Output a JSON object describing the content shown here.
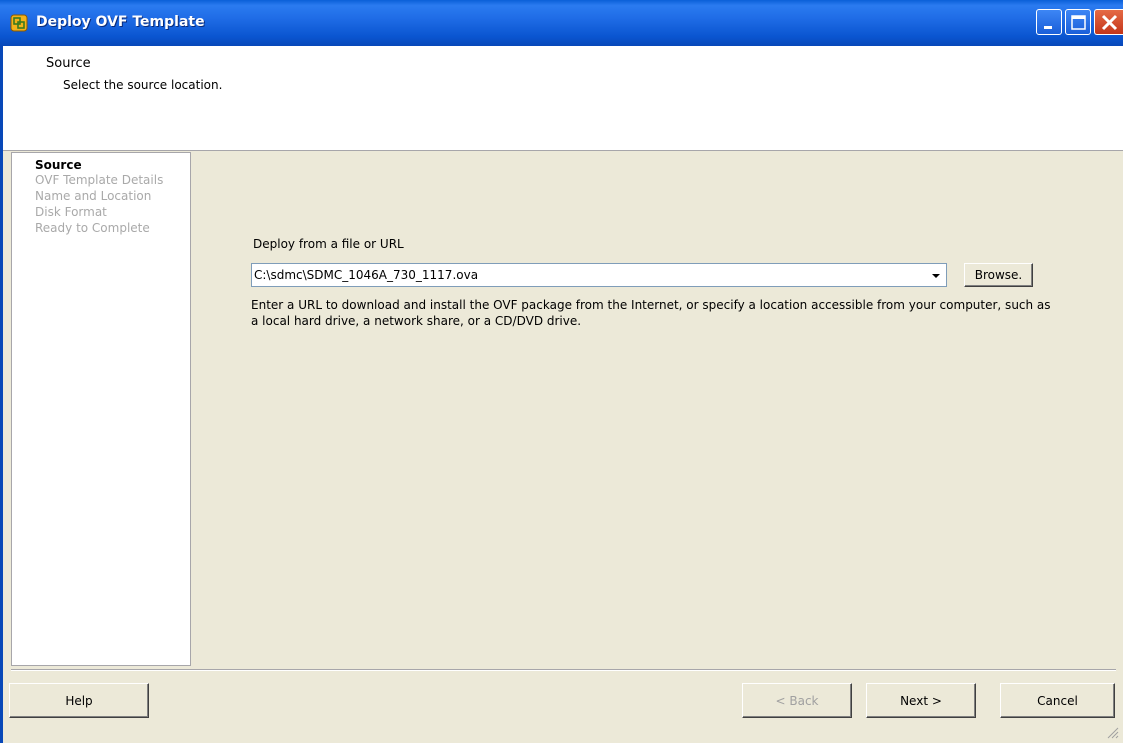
{
  "window": {
    "title": "Deploy OVF Template",
    "icons": {
      "app": "ovf-app-icon",
      "minimize": "minimize-icon",
      "maximize": "maximize-icon",
      "close": "close-icon"
    }
  },
  "header": {
    "title": "Source",
    "subtitle": "Select the source location."
  },
  "sidebar": {
    "steps": [
      {
        "label": "Source",
        "active": true
      },
      {
        "label": "OVF Template Details",
        "active": false
      },
      {
        "label": "Name and Location",
        "active": false
      },
      {
        "label": "Disk Format",
        "active": false
      },
      {
        "label": "Ready to Complete",
        "active": false
      }
    ]
  },
  "main": {
    "field_label": "Deploy from a file or URL",
    "source_value": "C:\\sdmc\\SDMC_1046A_730_1117.ova",
    "browse_label": "Browse.",
    "help_text": "Enter a URL to download and install the OVF package from the Internet, or specify a location accessible from your computer, such as a local hard drive, a network share, or a CD/DVD drive."
  },
  "footer": {
    "help_label": "Help",
    "back_label": "< Back",
    "back_enabled": false,
    "next_label": "Next >",
    "cancel_label": "Cancel"
  },
  "colors": {
    "titlebar": "#0A55D0",
    "panel_bg": "#ECE9D8",
    "disabled_text": "#A9A9A9"
  }
}
